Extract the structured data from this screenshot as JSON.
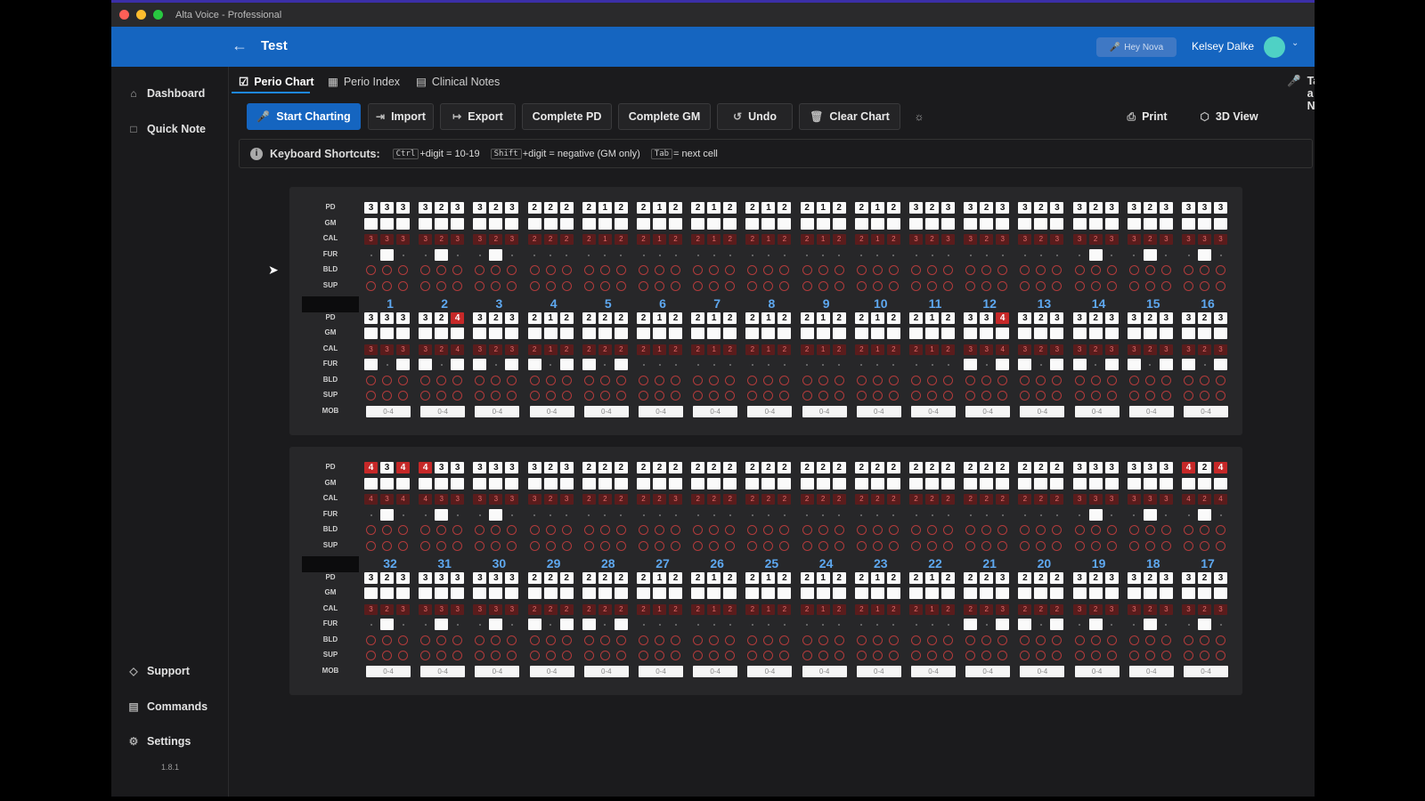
{
  "window": {
    "title": "Alta Voice - Professional",
    "traffic_colors": [
      "#ff5f57",
      "#febc2e",
      "#28c840"
    ]
  },
  "header": {
    "back_icon": "arrow-left-icon",
    "title": "Test",
    "hey_nova": "Hey Nova",
    "user_name": "Kelsey Dalke",
    "accent": "#1565c0"
  },
  "sidebar": {
    "items": [
      {
        "label": "Dashboard",
        "icon": "home-icon"
      },
      {
        "label": "Quick Note",
        "icon": "note-icon"
      }
    ],
    "bottom_items": [
      {
        "label": "Support",
        "icon": "support-icon"
      },
      {
        "label": "Commands",
        "icon": "commands-icon"
      },
      {
        "label": "Settings",
        "icon": "gear-icon"
      }
    ],
    "version": "1.8.1"
  },
  "tabs": [
    {
      "label": "Perio Chart",
      "active": true
    },
    {
      "label": "Perio Index",
      "active": false
    },
    {
      "label": "Clinical Notes",
      "active": false
    }
  ],
  "take_note": "Take a Note",
  "toolbar": {
    "start_charting": "Start Charting",
    "import": "Import",
    "export": "Export",
    "complete_pd": "Complete PD",
    "complete_gm": "Complete GM",
    "undo": "Undo",
    "clear_chart": "Clear Chart",
    "print": "Print",
    "view_3d": "3D View"
  },
  "shortcuts": {
    "label": "Keyboard Shortcuts:",
    "items": [
      {
        "key": "Ctrl",
        "text": "+digit = 10-19"
      },
      {
        "key": "Shift",
        "text": "+digit = negative (GM only)"
      },
      {
        "key": "Tab",
        "text": "= next cell"
      }
    ]
  },
  "row_labels": {
    "pd": "PD",
    "gm": "GM",
    "cal": "CAL",
    "fur": "FUR",
    "bld": "BLD",
    "sup": "SUP",
    "mob": "MOB"
  },
  "mob_placeholder": "0-4",
  "upper": {
    "numbers": [
      "1",
      "2",
      "3",
      "4",
      "5",
      "6",
      "7",
      "8",
      "9",
      "10",
      "11",
      "12",
      "13",
      "14",
      "15",
      "16"
    ],
    "top": {
      "pd": [
        [
          3,
          3,
          3
        ],
        [
          3,
          2,
          3
        ],
        [
          3,
          2,
          3
        ],
        [
          2,
          2,
          2
        ],
        [
          2,
          1,
          2
        ],
        [
          2,
          1,
          2
        ],
        [
          2,
          1,
          2
        ],
        [
          2,
          1,
          2
        ],
        [
          2,
          1,
          2
        ],
        [
          2,
          1,
          2
        ],
        [
          3,
          2,
          3
        ],
        [
          3,
          2,
          3
        ],
        [
          3,
          2,
          3
        ],
        [
          3,
          2,
          3
        ],
        [
          3,
          2,
          3
        ],
        [
          3,
          3,
          3
        ]
      ],
      "pd_red": [
        [
          0,
          0,
          0
        ],
        [
          0,
          0,
          0
        ],
        [
          0,
          0,
          0
        ],
        [
          0,
          0,
          0
        ],
        [
          0,
          0,
          0
        ],
        [
          0,
          0,
          0
        ],
        [
          0,
          0,
          0
        ],
        [
          0,
          0,
          0
        ],
        [
          0,
          0,
          0
        ],
        [
          0,
          0,
          0
        ],
        [
          0,
          0,
          0
        ],
        [
          0,
          0,
          0
        ],
        [
          0,
          0,
          0
        ],
        [
          0,
          0,
          0
        ],
        [
          0,
          0,
          0
        ],
        [
          0,
          0,
          0
        ]
      ],
      "cal": [
        [
          3,
          3,
          3
        ],
        [
          3,
          2,
          3
        ],
        [
          3,
          2,
          3
        ],
        [
          2,
          2,
          2
        ],
        [
          2,
          1,
          2
        ],
        [
          2,
          1,
          2
        ],
        [
          2,
          1,
          2
        ],
        [
          2,
          1,
          2
        ],
        [
          2,
          1,
          2
        ],
        [
          2,
          1,
          2
        ],
        [
          3,
          2,
          3
        ],
        [
          3,
          2,
          3
        ],
        [
          3,
          2,
          3
        ],
        [
          3,
          2,
          3
        ],
        [
          3,
          2,
          3
        ],
        [
          3,
          3,
          3
        ]
      ],
      "fur": [
        [
          0,
          1,
          0
        ],
        [
          0,
          1,
          0
        ],
        [
          0,
          1,
          0
        ],
        [
          0,
          0,
          0
        ],
        [
          0,
          0,
          0
        ],
        [
          0,
          0,
          0
        ],
        [
          0,
          0,
          0
        ],
        [
          0,
          0,
          0
        ],
        [
          0,
          0,
          0
        ],
        [
          0,
          0,
          0
        ],
        [
          0,
          0,
          0
        ],
        [
          0,
          0,
          0
        ],
        [
          0,
          0,
          0
        ],
        [
          0,
          1,
          0
        ],
        [
          0,
          1,
          0
        ],
        [
          0,
          1,
          0
        ]
      ]
    },
    "bottom": {
      "pd": [
        [
          3,
          3,
          3
        ],
        [
          3,
          2,
          4
        ],
        [
          3,
          2,
          3
        ],
        [
          2,
          1,
          2
        ],
        [
          2,
          2,
          2
        ],
        [
          2,
          1,
          2
        ],
        [
          2,
          1,
          2
        ],
        [
          2,
          1,
          2
        ],
        [
          2,
          1,
          2
        ],
        [
          2,
          1,
          2
        ],
        [
          2,
          1,
          2
        ],
        [
          3,
          3,
          4
        ],
        [
          3,
          2,
          3
        ],
        [
          3,
          2,
          3
        ],
        [
          3,
          2,
          3
        ],
        [
          3,
          2,
          3
        ]
      ],
      "pd_red": [
        [
          0,
          0,
          0
        ],
        [
          0,
          0,
          1
        ],
        [
          0,
          0,
          0
        ],
        [
          0,
          0,
          0
        ],
        [
          0,
          0,
          0
        ],
        [
          0,
          0,
          0
        ],
        [
          0,
          0,
          0
        ],
        [
          0,
          0,
          0
        ],
        [
          0,
          0,
          0
        ],
        [
          0,
          0,
          0
        ],
        [
          0,
          0,
          0
        ],
        [
          0,
          0,
          1
        ],
        [
          0,
          0,
          0
        ],
        [
          0,
          0,
          0
        ],
        [
          0,
          0,
          0
        ],
        [
          0,
          0,
          0
        ]
      ],
      "cal": [
        [
          3,
          3,
          3
        ],
        [
          3,
          2,
          4
        ],
        [
          3,
          2,
          3
        ],
        [
          2,
          1,
          2
        ],
        [
          2,
          2,
          2
        ],
        [
          2,
          1,
          2
        ],
        [
          2,
          1,
          2
        ],
        [
          2,
          1,
          2
        ],
        [
          2,
          1,
          2
        ],
        [
          2,
          1,
          2
        ],
        [
          2,
          1,
          2
        ],
        [
          3,
          3,
          4
        ],
        [
          3,
          2,
          3
        ],
        [
          3,
          2,
          3
        ],
        [
          3,
          2,
          3
        ],
        [
          3,
          2,
          3
        ]
      ],
      "fur": [
        [
          1,
          0,
          1
        ],
        [
          1,
          0,
          1
        ],
        [
          1,
          0,
          1
        ],
        [
          1,
          0,
          1
        ],
        [
          1,
          0,
          1
        ],
        [
          0,
          0,
          0
        ],
        [
          0,
          0,
          0
        ],
        [
          0,
          0,
          0
        ],
        [
          0,
          0,
          0
        ],
        [
          0,
          0,
          0
        ],
        [
          0,
          0,
          0
        ],
        [
          1,
          0,
          1
        ],
        [
          1,
          0,
          1
        ],
        [
          1,
          0,
          1
        ],
        [
          1,
          0,
          1
        ],
        [
          1,
          0,
          1
        ]
      ]
    }
  },
  "lower": {
    "numbers": [
      "32",
      "31",
      "30",
      "29",
      "28",
      "27",
      "26",
      "25",
      "24",
      "23",
      "22",
      "21",
      "20",
      "19",
      "18",
      "17"
    ],
    "top": {
      "pd": [
        [
          4,
          3,
          4
        ],
        [
          4,
          3,
          3
        ],
        [
          3,
          3,
          3
        ],
        [
          3,
          2,
          3
        ],
        [
          2,
          2,
          2
        ],
        [
          2,
          2,
          2
        ],
        [
          2,
          2,
          2
        ],
        [
          2,
          2,
          2
        ],
        [
          2,
          2,
          2
        ],
        [
          2,
          2,
          2
        ],
        [
          2,
          2,
          2
        ],
        [
          2,
          2,
          2
        ],
        [
          2,
          2,
          2
        ],
        [
          3,
          3,
          3
        ],
        [
          3,
          3,
          3
        ],
        [
          4,
          2,
          4
        ]
      ],
      "pd_red": [
        [
          1,
          0,
          1
        ],
        [
          1,
          0,
          0
        ],
        [
          0,
          0,
          0
        ],
        [
          0,
          0,
          0
        ],
        [
          0,
          0,
          0
        ],
        [
          0,
          0,
          0
        ],
        [
          0,
          0,
          0
        ],
        [
          0,
          0,
          0
        ],
        [
          0,
          0,
          0
        ],
        [
          0,
          0,
          0
        ],
        [
          0,
          0,
          0
        ],
        [
          0,
          0,
          0
        ],
        [
          0,
          0,
          0
        ],
        [
          0,
          0,
          0
        ],
        [
          0,
          0,
          0
        ],
        [
          1,
          0,
          1
        ]
      ],
      "cal": [
        [
          4,
          3,
          4
        ],
        [
          4,
          3,
          3
        ],
        [
          3,
          3,
          3
        ],
        [
          3,
          2,
          3
        ],
        [
          2,
          2,
          2
        ],
        [
          2,
          2,
          3
        ],
        [
          2,
          2,
          2
        ],
        [
          2,
          2,
          2
        ],
        [
          2,
          2,
          2
        ],
        [
          2,
          2,
          2
        ],
        [
          2,
          2,
          2
        ],
        [
          2,
          2,
          2
        ],
        [
          2,
          2,
          2
        ],
        [
          3,
          3,
          3
        ],
        [
          3,
          3,
          3
        ],
        [
          4,
          2,
          4
        ]
      ],
      "fur": [
        [
          0,
          1,
          0
        ],
        [
          0,
          1,
          0
        ],
        [
          0,
          1,
          0
        ],
        [
          0,
          0,
          0
        ],
        [
          0,
          0,
          0
        ],
        [
          0,
          0,
          0
        ],
        [
          0,
          0,
          0
        ],
        [
          0,
          0,
          0
        ],
        [
          0,
          0,
          0
        ],
        [
          0,
          0,
          0
        ],
        [
          0,
          0,
          0
        ],
        [
          0,
          0,
          0
        ],
        [
          0,
          0,
          0
        ],
        [
          0,
          1,
          0
        ],
        [
          0,
          1,
          0
        ],
        [
          0,
          1,
          0
        ]
      ]
    },
    "bottom": {
      "pd": [
        [
          3,
          2,
          3
        ],
        [
          3,
          3,
          3
        ],
        [
          3,
          3,
          3
        ],
        [
          2,
          2,
          2
        ],
        [
          2,
          2,
          2
        ],
        [
          2,
          1,
          2
        ],
        [
          2,
          1,
          2
        ],
        [
          2,
          1,
          2
        ],
        [
          2,
          1,
          2
        ],
        [
          2,
          1,
          2
        ],
        [
          2,
          1,
          2
        ],
        [
          2,
          2,
          3
        ],
        [
          2,
          2,
          2
        ],
        [
          3,
          2,
          3
        ],
        [
          3,
          2,
          3
        ],
        [
          3,
          2,
          3
        ]
      ],
      "pd_red": [
        [
          0,
          0,
          0
        ],
        [
          0,
          0,
          0
        ],
        [
          0,
          0,
          0
        ],
        [
          0,
          0,
          0
        ],
        [
          0,
          0,
          0
        ],
        [
          0,
          0,
          0
        ],
        [
          0,
          0,
          0
        ],
        [
          0,
          0,
          0
        ],
        [
          0,
          0,
          0
        ],
        [
          0,
          0,
          0
        ],
        [
          0,
          0,
          0
        ],
        [
          0,
          0,
          0
        ],
        [
          0,
          0,
          0
        ],
        [
          0,
          0,
          0
        ],
        [
          0,
          0,
          0
        ],
        [
          0,
          0,
          0
        ]
      ],
      "cal": [
        [
          3,
          2,
          3
        ],
        [
          3,
          3,
          3
        ],
        [
          3,
          3,
          3
        ],
        [
          2,
          2,
          2
        ],
        [
          2,
          2,
          2
        ],
        [
          2,
          1,
          2
        ],
        [
          2,
          1,
          2
        ],
        [
          2,
          1,
          2
        ],
        [
          2,
          1,
          2
        ],
        [
          2,
          1,
          2
        ],
        [
          2,
          1,
          2
        ],
        [
          2,
          2,
          3
        ],
        [
          2,
          2,
          2
        ],
        [
          3,
          2,
          3
        ],
        [
          3,
          2,
          3
        ],
        [
          3,
          2,
          3
        ]
      ],
      "fur": [
        [
          0,
          1,
          0
        ],
        [
          0,
          1,
          0
        ],
        [
          0,
          1,
          0
        ],
        [
          1,
          0,
          1
        ],
        [
          1,
          0,
          1
        ],
        [
          0,
          0,
          0
        ],
        [
          0,
          0,
          0
        ],
        [
          0,
          0,
          0
        ],
        [
          0,
          0,
          0
        ],
        [
          0,
          0,
          0
        ],
        [
          0,
          0,
          0
        ],
        [
          1,
          0,
          1
        ],
        [
          1,
          0,
          1
        ],
        [
          0,
          1,
          0
        ],
        [
          0,
          1,
          0
        ],
        [
          0,
          1,
          0
        ]
      ]
    }
  }
}
